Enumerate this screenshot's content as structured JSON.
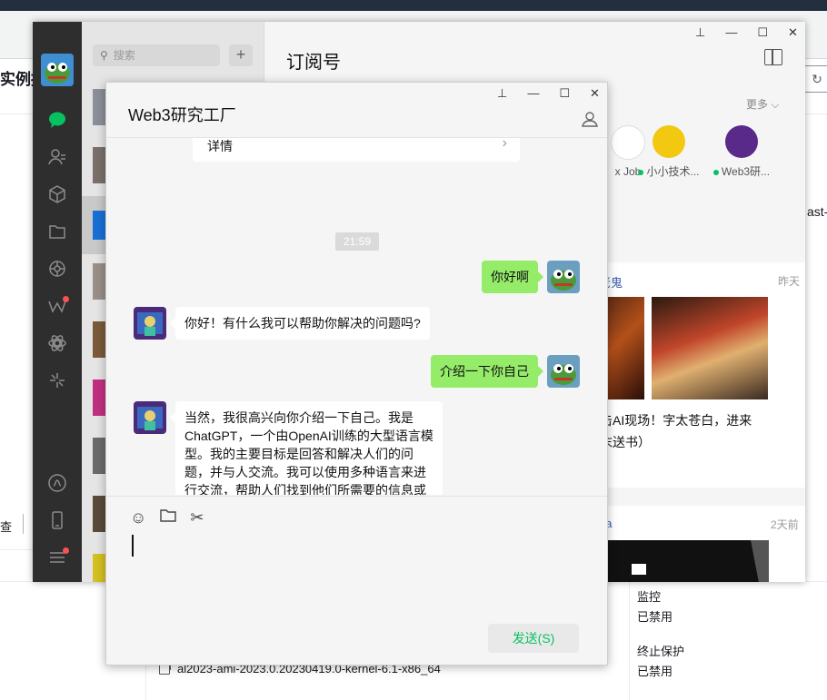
{
  "aws": {
    "title_fragment": "实例摘",
    "refresh_icon": "refresh-icon",
    "side_text": "ast-",
    "bottom_left_fragment": "查",
    "monitoring_label": "监控",
    "monitoring_value": "已禁用",
    "termination_label": "终止保护",
    "termination_value": "已禁用",
    "ami_name": "al2023-ami-2023.0.20230419.0-kernel-6.1-x86_64"
  },
  "wechat": {
    "search_placeholder": "搜索",
    "add_button": "+",
    "content_title": "订阅号",
    "more_link": "更多",
    "subscriptions": [
      {
        "label": "x Job"
      },
      {
        "label": "小小技术..."
      },
      {
        "label": "Web3研..."
      }
    ],
    "article1": {
      "source": "员老鬼",
      "time": "昨天",
      "title_line1": "袭击AI现场！字太苍白，进来",
      "title_line2": "文末送书）"
    },
    "article2": {
      "source": "Java",
      "time": "2天前"
    }
  },
  "chat": {
    "title": "Web3研究工厂",
    "link_card_label": "详情",
    "time_tag": "21:59",
    "messages": [
      {
        "from": "me",
        "text": "你好啊"
      },
      {
        "from": "them",
        "text": "你好！有什么我可以帮助你解决的问题吗?"
      },
      {
        "from": "me",
        "text": "介绍一下你自己"
      },
      {
        "from": "them",
        "text": "当然，我很高兴向你介绍一下自己。我是ChatGPT，一个由OpenAI训练的大型语言模型。我的主要目标是回答和解决人们的问题，并与人交流。我可以使用多种语言来进行交流，帮助人们找到他们所需要的信息或解决问题。如果你有任何疑问，请随时问我！"
      }
    ],
    "send_button": "发送(S)"
  },
  "colors": {
    "accent_green": "#07c160",
    "my_bubble": "#95ec69",
    "nav_dark": "#2e2e2e"
  }
}
